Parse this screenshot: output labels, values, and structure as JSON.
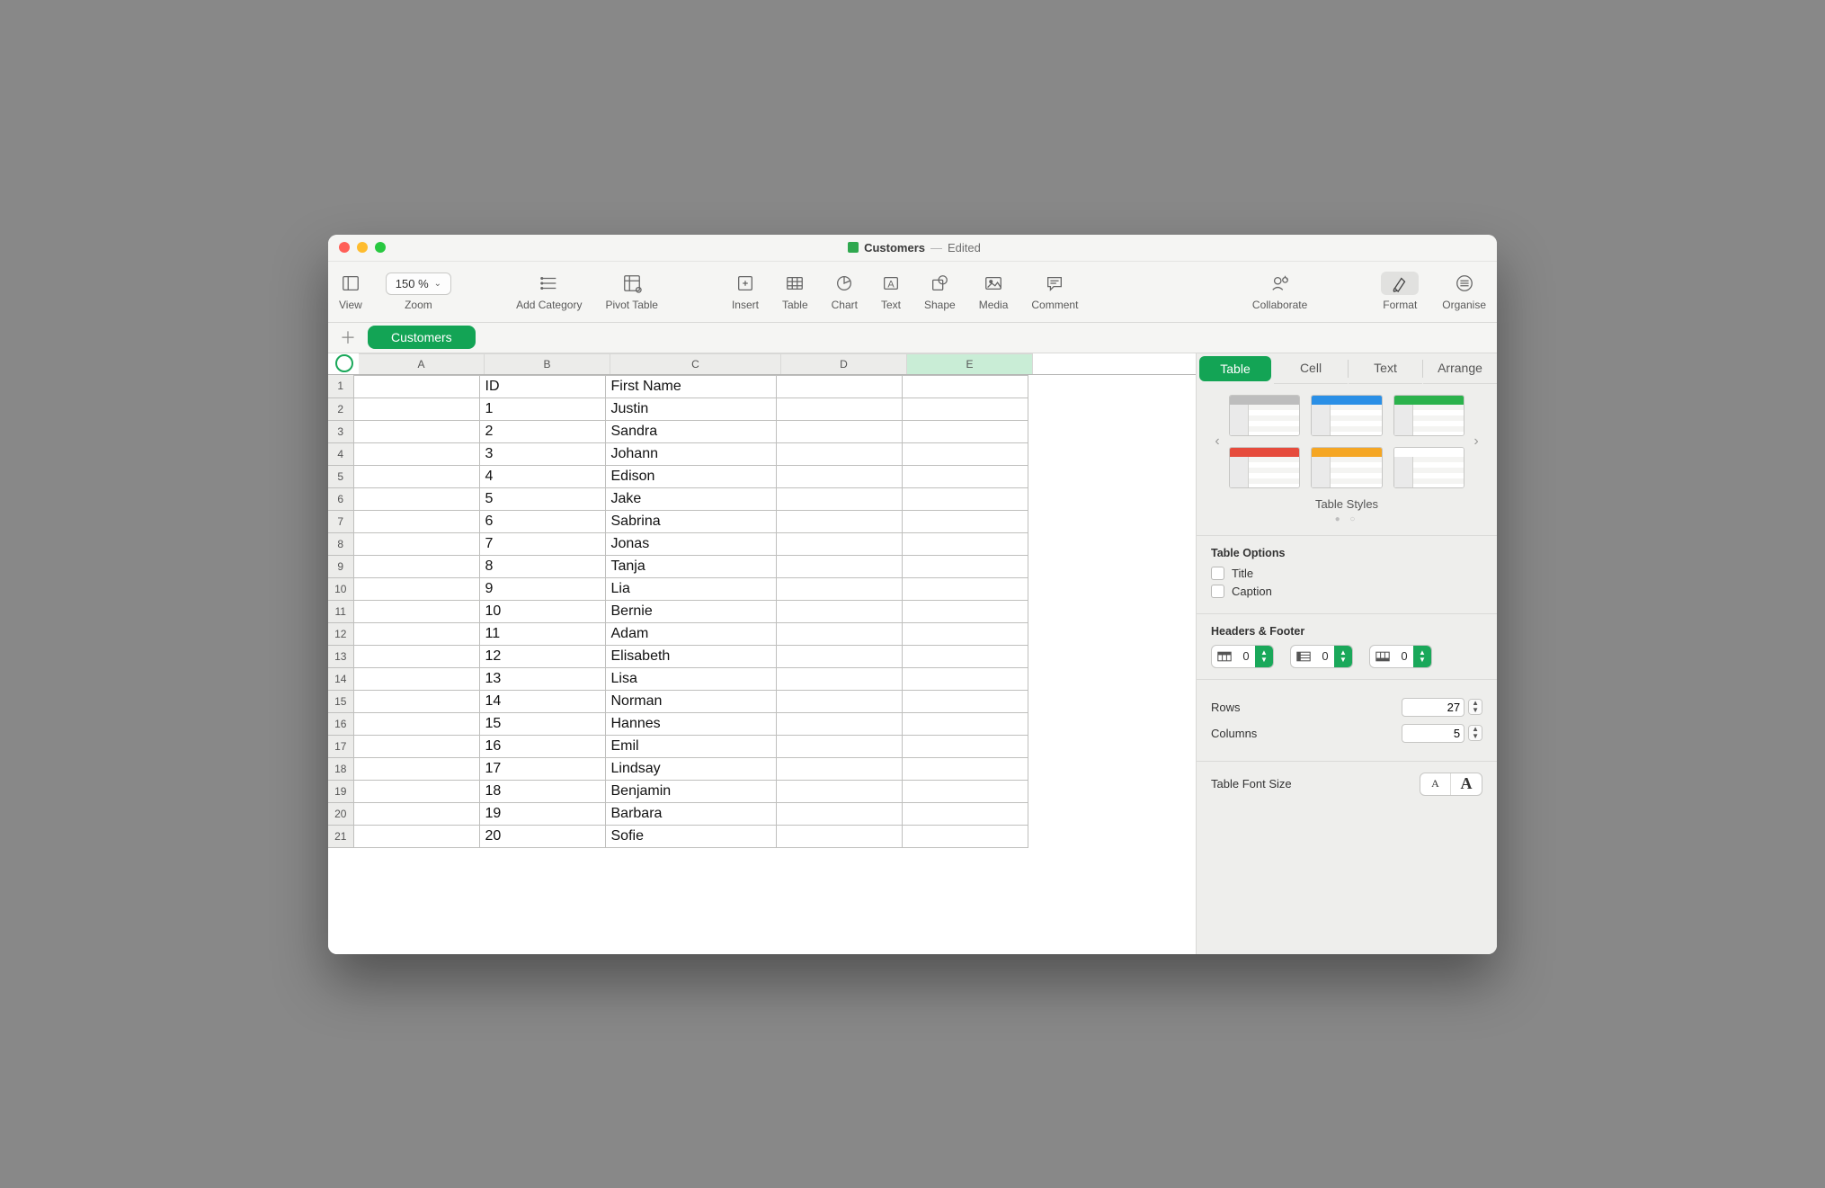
{
  "title": {
    "docname": "Customers",
    "status": "Edited"
  },
  "toolbar": {
    "view": "View",
    "zoom": "Zoom",
    "zoom_value": "150 %",
    "add_category": "Add Category",
    "pivot": "Pivot Table",
    "insert": "Insert",
    "table": "Table",
    "chart": "Chart",
    "text": "Text",
    "shape": "Shape",
    "media": "Media",
    "comment": "Comment",
    "collaborate": "Collaborate",
    "format": "Format",
    "organise": "Organise"
  },
  "sheet": {
    "active": "Customers"
  },
  "columns": [
    "A",
    "B",
    "C",
    "D",
    "E"
  ],
  "rows": [
    {
      "n": 1,
      "A": "",
      "B": "ID",
      "C": "First Name",
      "D": "",
      "E": ""
    },
    {
      "n": 2,
      "A": "",
      "B": "1",
      "C": "Justin",
      "D": "",
      "E": ""
    },
    {
      "n": 3,
      "A": "",
      "B": "2",
      "C": "Sandra",
      "D": "",
      "E": ""
    },
    {
      "n": 4,
      "A": "",
      "B": "3",
      "C": "Johann",
      "D": "",
      "E": ""
    },
    {
      "n": 5,
      "A": "",
      "B": "4",
      "C": "Edison",
      "D": "",
      "E": ""
    },
    {
      "n": 6,
      "A": "",
      "B": "5",
      "C": "Jake",
      "D": "",
      "E": ""
    },
    {
      "n": 7,
      "A": "",
      "B": "6",
      "C": "Sabrina",
      "D": "",
      "E": ""
    },
    {
      "n": 8,
      "A": "",
      "B": "7",
      "C": "Jonas",
      "D": "",
      "E": ""
    },
    {
      "n": 9,
      "A": "",
      "B": "8",
      "C": "Tanja",
      "D": "",
      "E": ""
    },
    {
      "n": 10,
      "A": "",
      "B": "9",
      "C": "Lia",
      "D": "",
      "E": ""
    },
    {
      "n": 11,
      "A": "",
      "B": "10",
      "C": "Bernie",
      "D": "",
      "E": ""
    },
    {
      "n": 12,
      "A": "",
      "B": "11",
      "C": "Adam",
      "D": "",
      "E": ""
    },
    {
      "n": 13,
      "A": "",
      "B": "12",
      "C": "Elisabeth",
      "D": "",
      "E": ""
    },
    {
      "n": 14,
      "A": "",
      "B": "13",
      "C": "Lisa",
      "D": "",
      "E": ""
    },
    {
      "n": 15,
      "A": "",
      "B": "14",
      "C": "Norman",
      "D": "",
      "E": ""
    },
    {
      "n": 16,
      "A": "",
      "B": "15",
      "C": "Hannes",
      "D": "",
      "E": ""
    },
    {
      "n": 17,
      "A": "",
      "B": "16",
      "C": "Emil",
      "D": "",
      "E": ""
    },
    {
      "n": 18,
      "A": "",
      "B": "17",
      "C": "Lindsay",
      "D": "",
      "E": ""
    },
    {
      "n": 19,
      "A": "",
      "B": "18",
      "C": "Benjamin",
      "D": "",
      "E": ""
    },
    {
      "n": 20,
      "A": "",
      "B": "19",
      "C": "Barbara",
      "D": "",
      "E": ""
    },
    {
      "n": 21,
      "A": "",
      "B": "20",
      "C": "Sofie",
      "D": "",
      "E": ""
    }
  ],
  "inspector": {
    "tabs": {
      "table": "Table",
      "cell": "Cell",
      "text": "Text",
      "arrange": "Arrange"
    },
    "styles_caption": "Table Styles",
    "table_options": {
      "label": "Table Options",
      "title": "Title",
      "caption": "Caption"
    },
    "headers_footer": {
      "label": "Headers & Footer",
      "vals": [
        "0",
        "0",
        "0"
      ]
    },
    "rows": {
      "label": "Rows",
      "value": "27"
    },
    "cols": {
      "label": "Columns",
      "value": "5"
    },
    "font_size": {
      "label": "Table Font Size"
    }
  }
}
